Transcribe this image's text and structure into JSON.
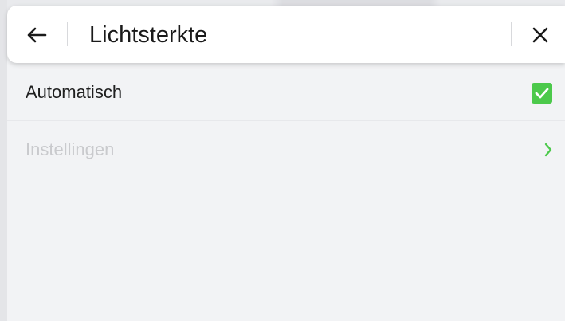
{
  "search": {
    "query": "Lichtsterkte",
    "back_icon": "arrow-left-icon",
    "close_icon": "close-icon"
  },
  "settings": {
    "automatic": {
      "label": "Automatisch",
      "checked": true,
      "icon": "checkbox-checked-icon"
    },
    "settings_link": {
      "label": "Instellingen",
      "enabled": false,
      "icon": "chevron-right-icon"
    }
  },
  "colors": {
    "accent": "#4cc94b",
    "background": "#f2f3f5",
    "disabled_text": "#c9cacd",
    "text": "#1f1f1f"
  }
}
